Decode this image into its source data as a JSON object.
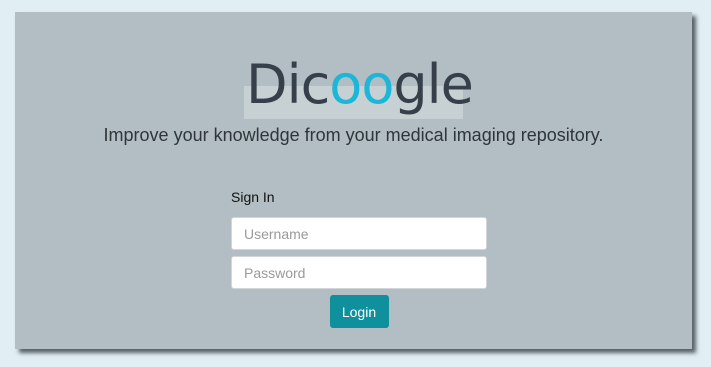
{
  "brand": {
    "logo_parts": [
      "Dic",
      "oo",
      "gle"
    ],
    "logo_accent_color": "#1bb6d8"
  },
  "tagline": "Improve your knowledge from your medical imaging repository.",
  "login_form": {
    "title": "Sign In",
    "username": {
      "value": "",
      "placeholder": "Username"
    },
    "password": {
      "value": "",
      "placeholder": "Password"
    },
    "submit_label": "Login",
    "submit_color": "#10909c"
  },
  "colors": {
    "page_background": "#e1eef4",
    "panel_background": "#b2bec3"
  }
}
